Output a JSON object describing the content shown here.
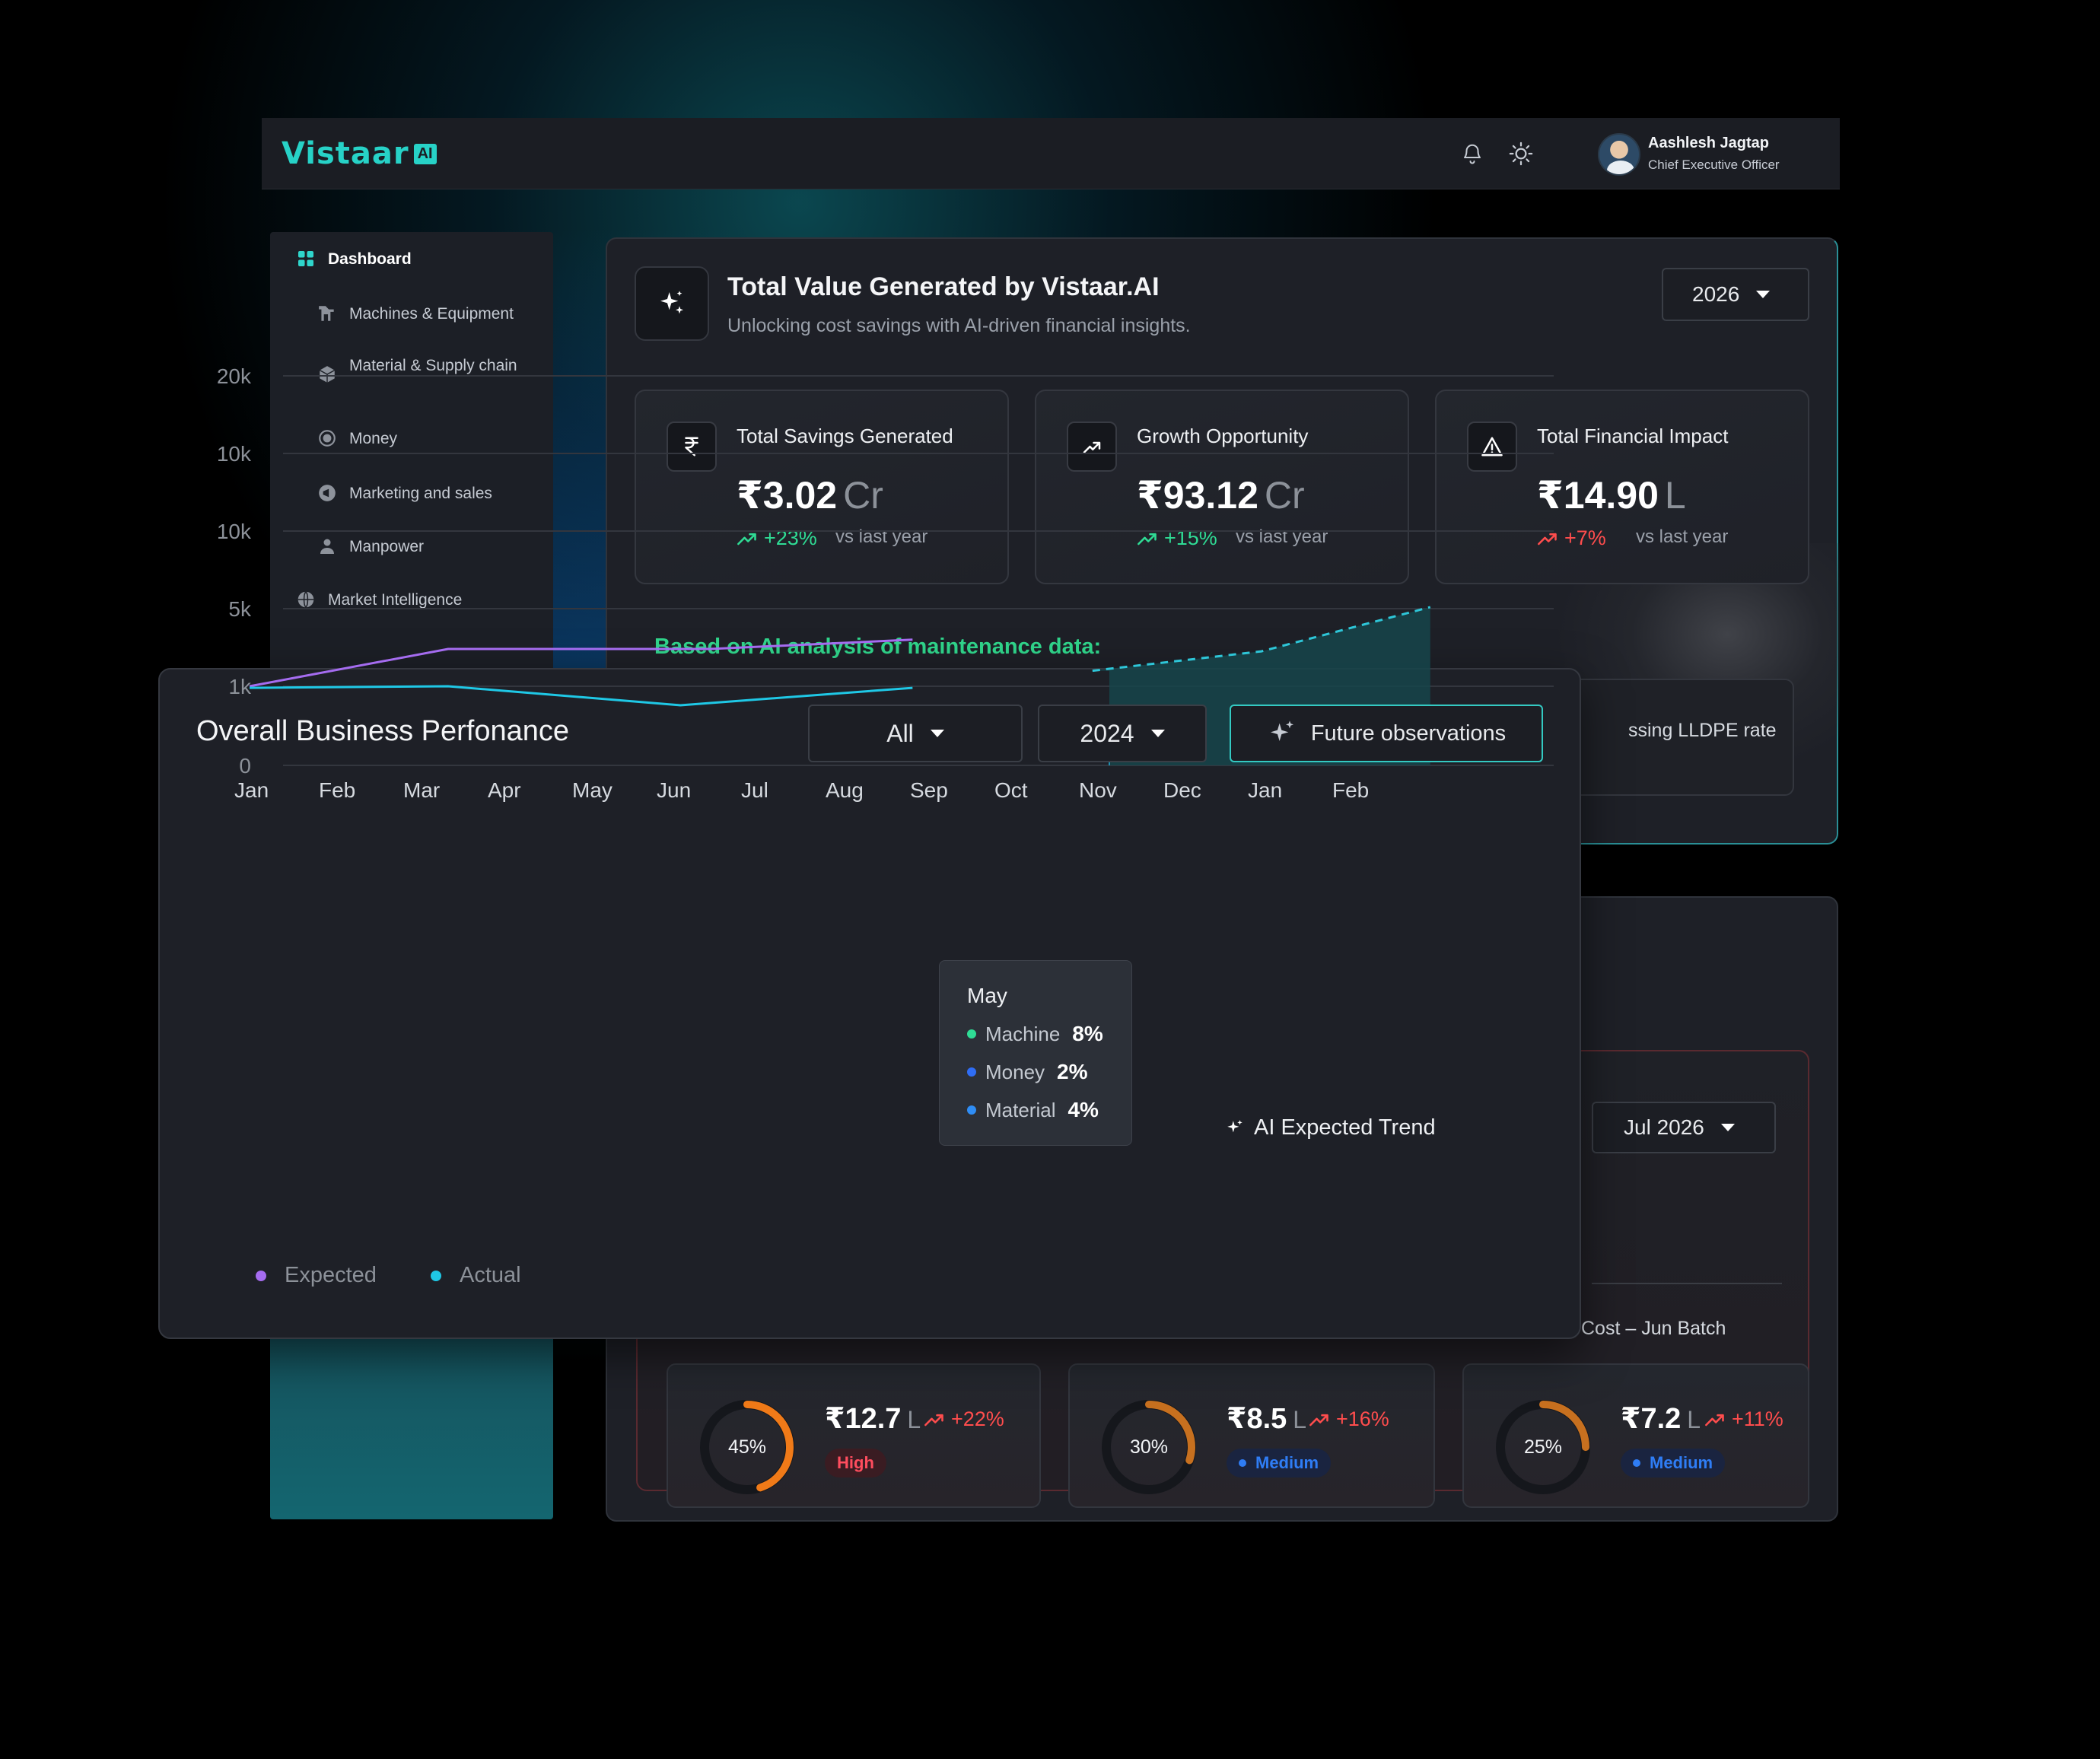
{
  "app": {
    "logo_text": "Vistaar",
    "logo_suffix": "AI",
    "user_name": "Aashlesh Jagtap",
    "user_role": "Chief Executive Officer"
  },
  "sidebar": {
    "items": [
      {
        "label": "Dashboard",
        "icon": "grid-icon",
        "active": true
      },
      {
        "label": "Machines & Equipment",
        "icon": "machine-icon"
      },
      {
        "label": "Material & Supply chain",
        "icon": "box-icon"
      },
      {
        "label": "Money",
        "icon": "money-icon"
      },
      {
        "label": "Marketing and sales",
        "icon": "megaphone-icon"
      },
      {
        "label": "Manpower",
        "icon": "person-icon"
      },
      {
        "label": "Market Intelligence",
        "icon": "globe-icon"
      }
    ]
  },
  "value_card": {
    "title": "Total Value Generated by Vistaar.AI",
    "subtitle": "Unlocking cost savings with AI-driven financial insights.",
    "year": "2026",
    "kpis": [
      {
        "label": "Total Savings Generated",
        "value": "₹3.02",
        "unit": "Cr",
        "delta": "+23%",
        "vs": "vs last year",
        "trend": "up"
      },
      {
        "label": "Growth Opportunity",
        "value": "₹93.12",
        "unit": "Cr",
        "delta": "+15%",
        "vs": "vs last year",
        "trend": "up"
      },
      {
        "label": "Total Financial Impact",
        "value": "₹14.90",
        "unit": "L",
        "delta": "+7%",
        "vs": "vs last year",
        "trend": "down"
      }
    ],
    "based_on": "Based on AI analysis of maintenance data:",
    "insight_text": "ssing LLDPE rate"
  },
  "lower_card": {
    "month": "Jul 2026",
    "batch_label": "Cost – Jun Batch",
    "items": [
      {
        "pct": "45%",
        "pct_value": 45,
        "value": "₹12.7",
        "unit": "L",
        "delta": "+22%",
        "badge": "High"
      },
      {
        "pct": "30%",
        "pct_value": 30,
        "value": "₹8.5",
        "unit": "L",
        "delta": "+16%",
        "badge": "Medium"
      },
      {
        "pct": "25%",
        "pct_value": 25,
        "value": "₹7.2",
        "unit": "L",
        "delta": "+11%",
        "badge": "Medium"
      }
    ]
  },
  "performance": {
    "title": "Overall Business Perfonance",
    "filter_all": "All",
    "filter_year": "2024",
    "future_button": "Future observations",
    "ai_trend_label": "AI Expected Trend",
    "tooltip": {
      "title": "May",
      "rows": [
        {
          "label": "Machine",
          "value": "8%",
          "color": "#2fdc95"
        },
        {
          "label": "Money",
          "value": "2%",
          "color": "#2f6df5"
        },
        {
          "label": "Material",
          "value": "4%",
          "color": "#2f8df5"
        }
      ]
    },
    "legend": [
      {
        "label": "Expected",
        "color": "#a56cf0"
      },
      {
        "label": "Actual",
        "color": "#1fc8e6"
      }
    ]
  },
  "chart_data": {
    "type": "line",
    "title": "Overall Business Perfonance",
    "categories": [
      "Jan",
      "Feb",
      "Mar",
      "Apr",
      "May",
      "Jun",
      "Jul",
      "Aug",
      "Sep",
      "Oct",
      "Nov",
      "Dec",
      "Jan",
      "Feb"
    ],
    "y_tick_labels": [
      "0",
      "1k",
      "5k",
      "10k",
      "10k",
      "20k"
    ],
    "y_scale": "ordinal ticks (0, 1k, 5k, 10k, 10k, 20k)",
    "grid": true,
    "legend_position": "bottom-left",
    "series": [
      {
        "name": "Expected",
        "color": "#a56cf0",
        "points": [
          [
            0,
            1.0
          ],
          [
            2.35,
            1.48
          ],
          [
            5.45,
            1.48
          ],
          [
            7.85,
            1.6
          ]
        ]
      },
      {
        "name": "Actual",
        "color": "#1fc8e6",
        "points": [
          [
            0,
            0.98
          ],
          [
            2.35,
            1.0
          ],
          [
            5.1,
            0.76
          ],
          [
            7.85,
            0.98
          ]
        ]
      },
      {
        "name": "AI Expected Trend",
        "color": "#2ec6d8",
        "dashed": true,
        "points": [
          [
            9.9,
            1.2
          ],
          [
            11.9,
            1.45
          ],
          [
            13.9,
            2.02
          ]
        ]
      }
    ],
    "highlight": {
      "x_start": "Nov",
      "x_end": "Feb"
    },
    "tooltip_category": "May"
  }
}
